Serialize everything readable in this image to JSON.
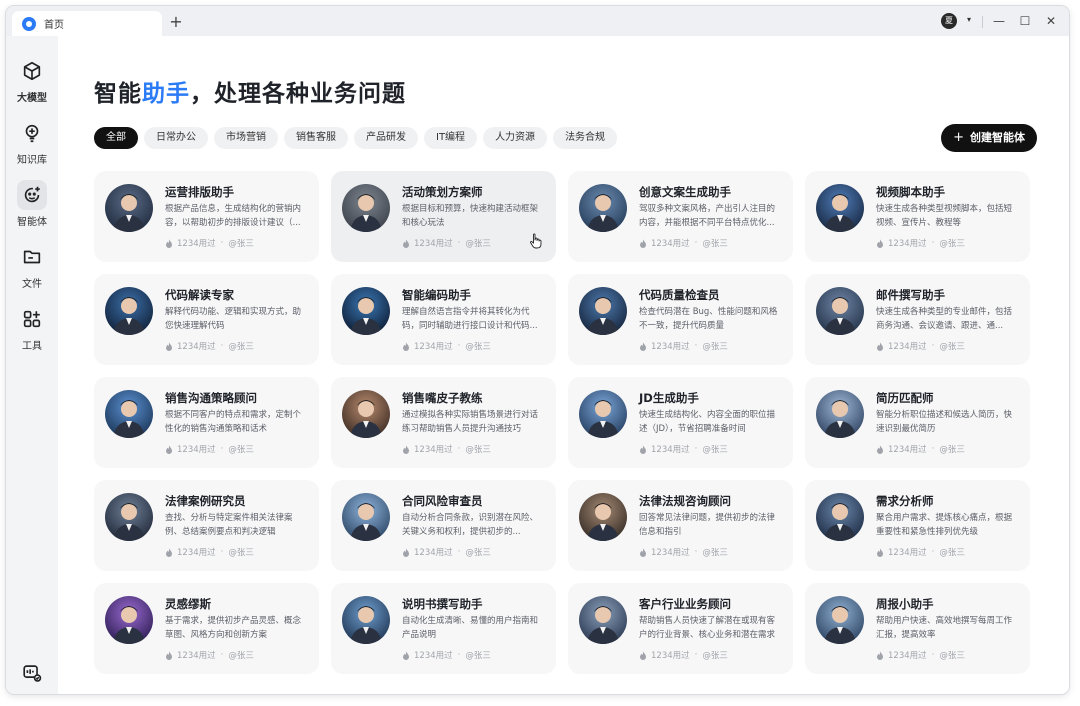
{
  "tab": {
    "title": "首页",
    "new_tab": "+"
  },
  "window_controls": {
    "avatar_text": "夏",
    "caret": "▾",
    "minimize": "—",
    "maximize": "☐",
    "close": "✕"
  },
  "sidebar": {
    "items": [
      {
        "label": "大模型",
        "icon": "cube-icon"
      },
      {
        "label": "知识库",
        "icon": "bulb-icon"
      },
      {
        "label": "智能体",
        "icon": "agent-icon"
      },
      {
        "label": "文件",
        "icon": "folder-icon"
      },
      {
        "label": "工具",
        "icon": "tools-icon"
      }
    ],
    "bottom_icon": "assistant-icon"
  },
  "heading": {
    "prefix": "智能",
    "accent": "助手",
    "suffix": "，处理各种业务问题"
  },
  "filters": [
    "全部",
    "日常办公",
    "市场营销",
    "销售客服",
    "产品研发",
    "IT编程",
    "人力资源",
    "法务合规"
  ],
  "create_button": {
    "plus": "+",
    "label": "创建智能体"
  },
  "colors": {
    "accent": "#2b7bf6",
    "active_chip": "#111111",
    "card_bg": "#f7f7f8"
  },
  "cards": [
    {
      "title": "运营排版助手",
      "desc": "根据产品信息，生成结构化的营销内容，以帮助初步的排版设计建议（...",
      "uses": "1234用过",
      "author": "@张三"
    },
    {
      "title": "活动策划方案师",
      "desc": "根据目标和预算，快速构建活动框架和核心玩法",
      "uses": "1234用过",
      "author": "@张三"
    },
    {
      "title": "创意文案生成助手",
      "desc": "驾驭多种文案风格，产出引人注目的内容，并能根据不同平台特点优化...",
      "uses": "1234用过",
      "author": "@张三"
    },
    {
      "title": "视频脚本助手",
      "desc": "快速生成各种类型视频脚本，包括短视频、宣传片、教程等",
      "uses": "1234用过",
      "author": "@张三"
    },
    {
      "title": "代码解读专家",
      "desc": "解释代码功能、逻辑和实现方式，助您快速理解代码",
      "uses": "1234用过",
      "author": "@张三"
    },
    {
      "title": "智能编码助手",
      "desc": "理解自然语言指令并将其转化为代码，同时辅助进行接口设计和代码...",
      "uses": "1234用过",
      "author": "@张三"
    },
    {
      "title": "代码质量检查员",
      "desc": "检查代码潜在 Bug、性能问题和风格不一致，提升代码质量",
      "uses": "1234用过",
      "author": "@张三"
    },
    {
      "title": "邮件撰写助手",
      "desc": "快速生成各种类型的专业邮件，包括商务沟通、会议邀请、跟进、通...",
      "uses": "1234用过",
      "author": "@张三"
    },
    {
      "title": "销售沟通策略顾问",
      "desc": "根据不同客户的特点和需求，定制个性化的销售沟通策略和话术",
      "uses": "1234用过",
      "author": "@张三"
    },
    {
      "title": "销售嘴皮子教练",
      "desc": "通过模拟各种实际销售场景进行对话练习帮助销售人员提升沟通技巧",
      "uses": "1234用过",
      "author": "@张三"
    },
    {
      "title": "JD生成助手",
      "desc": "快速生成结构化、内容全面的职位描述（JD），节省招聘准备时间",
      "uses": "1234用过",
      "author": "@张三"
    },
    {
      "title": "简历匹配师",
      "desc": "智能分析职位描述和候选人简历，快速识别最优简历",
      "uses": "1234用过",
      "author": "@张三"
    },
    {
      "title": "法律案例研究员",
      "desc": "查找、分析与特定案件相关法律案例、总结案例要点和判决逻辑",
      "uses": "1234用过",
      "author": "@张三"
    },
    {
      "title": "合同风险审查员",
      "desc": "自动分析合同条款，识别潜在风险、关键义务和权利，提供初步的...",
      "uses": "1234用过",
      "author": "@张三"
    },
    {
      "title": "法律法规咨询顾问",
      "desc": "回答常见法律问题，提供初步的法律信息和指引",
      "uses": "1234用过",
      "author": "@张三"
    },
    {
      "title": "需求分析师",
      "desc": "聚合用户需求、提炼核心痛点，根据重要性和紧急性排列优先级",
      "uses": "1234用过",
      "author": "@张三"
    },
    {
      "title": "灵感缪斯",
      "desc": "基于需求，提供初步产品灵感、概念草图、风格方向和创新方案",
      "uses": "1234用过",
      "author": "@张三"
    },
    {
      "title": "说明书撰写助手",
      "desc": "自动化生成清晰、易懂的用户指南和产品说明",
      "uses": "1234用过",
      "author": "@张三"
    },
    {
      "title": "客户行业业务顾问",
      "desc": "帮助销售人员快速了解潜在或现有客户的行业背景、核心业务和潜在需求",
      "uses": "1234用过",
      "author": "@张三"
    },
    {
      "title": "周报小助手",
      "desc": "帮助用户快速、高效地撰写每周工作汇报，提高效率",
      "uses": "1234用过",
      "author": "@张三"
    }
  ]
}
